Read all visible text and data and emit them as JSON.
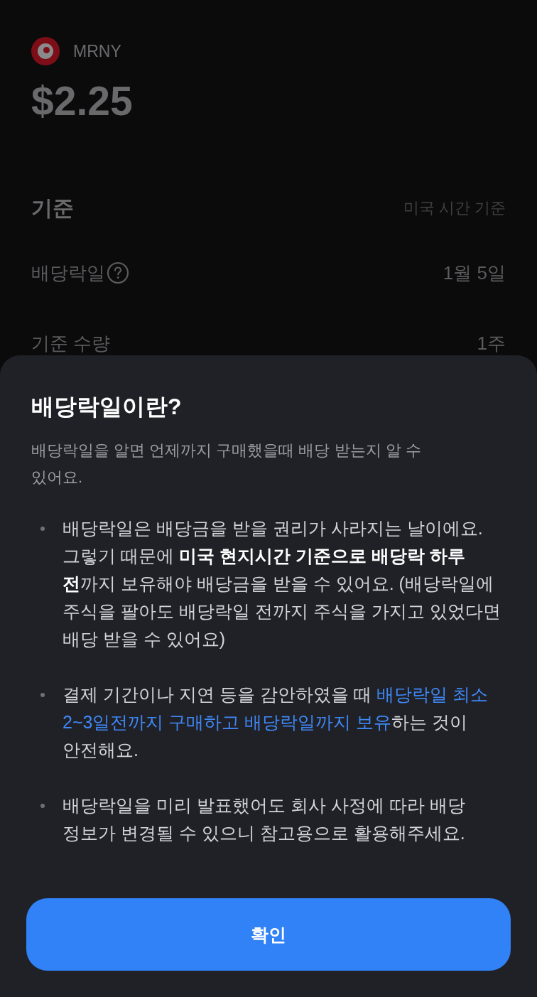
{
  "stock": {
    "ticker": "MRNY",
    "price": "$2.25"
  },
  "details": {
    "heading": "기준",
    "note": "미국 시간 기준",
    "rows": [
      {
        "label": "배당락일",
        "help": true,
        "value": "1월 5일"
      },
      {
        "label": "기준 수량",
        "help": false,
        "value": "1주"
      }
    ]
  },
  "sheet": {
    "title": "배당락일이란?",
    "description": "배당락일을 알면 언제까지 구매했을때 배당 받는지 알 수 있어요.",
    "bullets": [
      {
        "segments": [
          {
            "kind": "plain",
            "text": "배당락일은 배당금을 받을 권리가 사라지는 날이에요. 그렇기 때문에 "
          },
          {
            "kind": "strong",
            "text": "미국 현지시간 기준으로 배당락 하루 전"
          },
          {
            "kind": "plain",
            "text": "까지 보유해야 배당금을 받을 수 있어요. (배당락일에 주식을 팔아도 배당락일 전까지 주식을 가지고 있었다면 배당 받을 수 있어요)"
          }
        ]
      },
      {
        "segments": [
          {
            "kind": "plain",
            "text": "결제 기간이나 지연 등을 감안하였을 때 "
          },
          {
            "kind": "highlight",
            "text": "배당락일 최소 2~3일전까지 구매하고 배당락일까지 보유"
          },
          {
            "kind": "plain",
            "text": "하는 것이 안전해요."
          }
        ]
      },
      {
        "segments": [
          {
            "kind": "plain",
            "text": "배당락일을 미리 발표했어도 회사 사정에 따라 배당 정보가 변경될 수 있으니 참고용으로 활용해주세요."
          }
        ]
      }
    ],
    "button": "확인"
  }
}
